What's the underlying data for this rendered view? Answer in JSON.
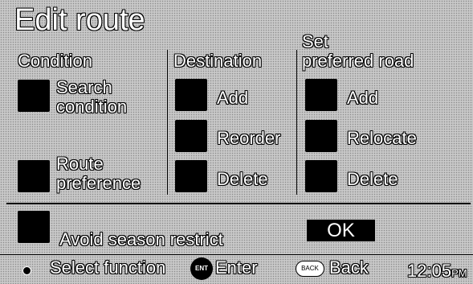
{
  "title": "Edit route",
  "columns": {
    "condition": {
      "header": "Condition",
      "items": [
        {
          "label_line1": "Search",
          "label_line2": "condition"
        },
        {
          "label_line1": "Route",
          "label_line2": "preference"
        }
      ]
    },
    "destination": {
      "header": "Destination",
      "items": [
        {
          "label": "Add"
        },
        {
          "label": "Reorder"
        },
        {
          "label": "Delete"
        }
      ]
    },
    "preferred_road": {
      "header_line1": "Set",
      "header_line2": "preferred road",
      "items": [
        {
          "label": "Add"
        },
        {
          "label": "Relocate"
        },
        {
          "label": "Delete"
        }
      ]
    }
  },
  "avoid_season_label": "Avoid season restrict",
  "ok_label": "OK",
  "statusbar": {
    "select_label": "Select function",
    "enter_icon_text": "ENT",
    "enter_label": "Enter",
    "back_icon_text": "BACK",
    "back_label": "Back",
    "clock_time": "12:05",
    "clock_ampm": "PM"
  }
}
